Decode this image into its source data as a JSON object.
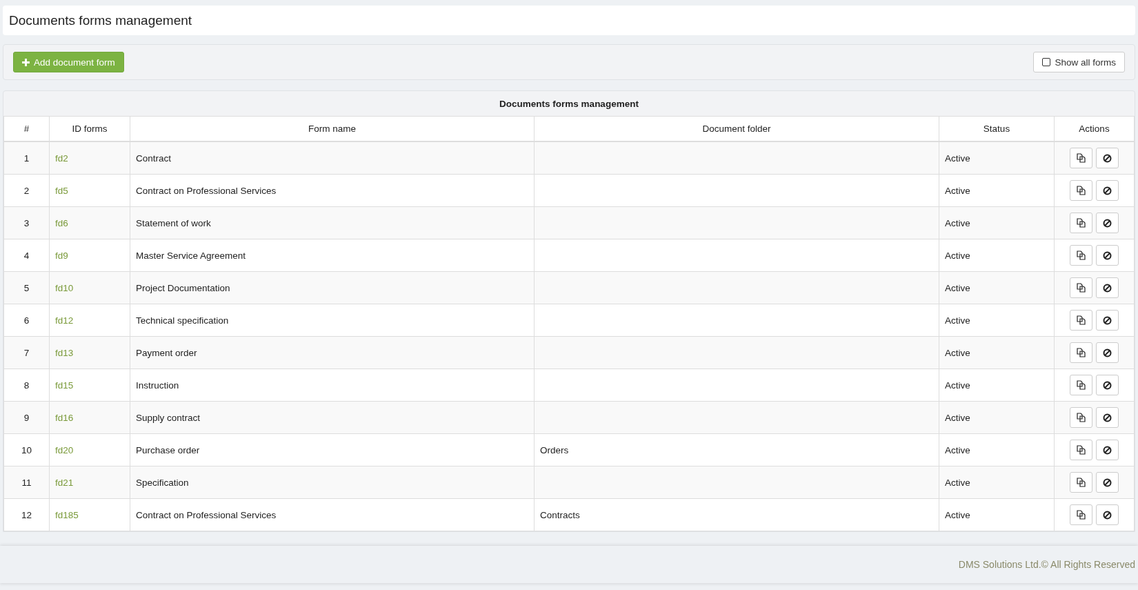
{
  "page_title": "Documents forms management",
  "toolbar": {
    "add_button": "Add document form",
    "show_all": {
      "label": "Show all forms",
      "checked": false
    }
  },
  "table": {
    "title": "Documents forms management",
    "columns": [
      "#",
      "ID forms",
      "Form name",
      "Document folder",
      "Status",
      "Actions"
    ],
    "rows": [
      {
        "num": "1",
        "id": "fd2",
        "name": "Contract",
        "folder": "",
        "status": "Active"
      },
      {
        "num": "2",
        "id": "fd5",
        "name": "Contract on Professional Services",
        "folder": "",
        "status": "Active"
      },
      {
        "num": "3",
        "id": "fd6",
        "name": "Statement of work",
        "folder": "",
        "status": "Active"
      },
      {
        "num": "4",
        "id": "fd9",
        "name": "Master Service Agreement",
        "folder": "",
        "status": "Active"
      },
      {
        "num": "5",
        "id": "fd10",
        "name": "Project Documentation",
        "folder": "",
        "status": "Active"
      },
      {
        "num": "6",
        "id": "fd12",
        "name": "Technical specification",
        "folder": "",
        "status": "Active"
      },
      {
        "num": "7",
        "id": "fd13",
        "name": "Payment order",
        "folder": "",
        "status": "Active"
      },
      {
        "num": "8",
        "id": "fd15",
        "name": "Instruction",
        "folder": "",
        "status": "Active"
      },
      {
        "num": "9",
        "id": "fd16",
        "name": "Supply contract",
        "folder": "",
        "status": "Active"
      },
      {
        "num": "10",
        "id": "fd20",
        "name": "Purchase order",
        "folder": "Orders",
        "status": "Active"
      },
      {
        "num": "11",
        "id": "fd21",
        "name": "Specification",
        "folder": "",
        "status": "Active"
      },
      {
        "num": "12",
        "id": "fd185",
        "name": "Contract on Professional Services",
        "folder": "Contracts",
        "status": "Active"
      }
    ]
  },
  "footer": "DMS Solutions Ltd.© All Rights Reserved"
}
